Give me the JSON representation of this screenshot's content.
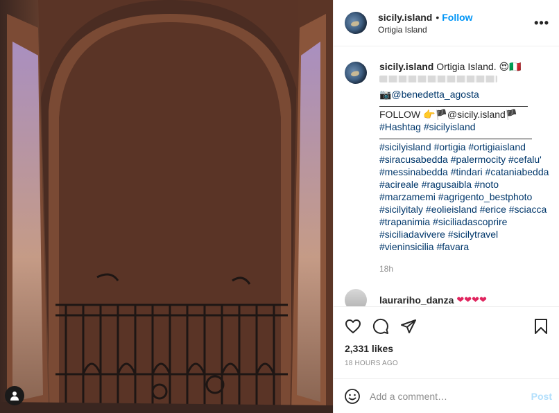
{
  "header": {
    "username": "sicily.island",
    "separator": "•",
    "follow_label": "Follow",
    "location": "Ortigia Island",
    "more_label": "•••"
  },
  "caption": {
    "username": "sicily.island",
    "text": "Ortigia Island. 😍🇮🇹",
    "photo_credit": "📷@benedetta_agosta",
    "follow_line": "FOLLOW 👉🏴@sicily.island🏴",
    "hashtag_line": "#Hashtag #sicilyisland",
    "hashtags": [
      "#sicilyisland #ortigia #ortigiaisland",
      "#siracusabedda #palermocity #cefalu'",
      "#messinabedda #tindari #cataniabedda",
      "#acireale #ragusaibla #noto",
      "#marzamemi #agrigento_bestphoto",
      "#sicilyitaly #eolieisland #erice #sciacca",
      "#trapanimia #siciliadascoprire",
      "#siciliadavivere #sicilytravel",
      "#vieninsicilia #favara"
    ],
    "time": "18h"
  },
  "comment": {
    "username": "laurariho_danza",
    "text": "❤❤❤❤"
  },
  "actions": {
    "likes": "2,331 likes",
    "timestamp": "18 HOURS AGO"
  },
  "add_comment": {
    "placeholder": "Add a comment…",
    "post_label": "Post"
  },
  "icons": {
    "like": "heart-icon",
    "comment": "comment-icon",
    "share": "paper-plane-icon",
    "save": "bookmark-icon",
    "emoji": "smiley-icon",
    "user_tag": "user-icon"
  },
  "colors": {
    "follow": "#0095f6",
    "hashtag": "#00376b",
    "post_disabled": "#b2dffc",
    "muted": "#8e8e8e"
  }
}
